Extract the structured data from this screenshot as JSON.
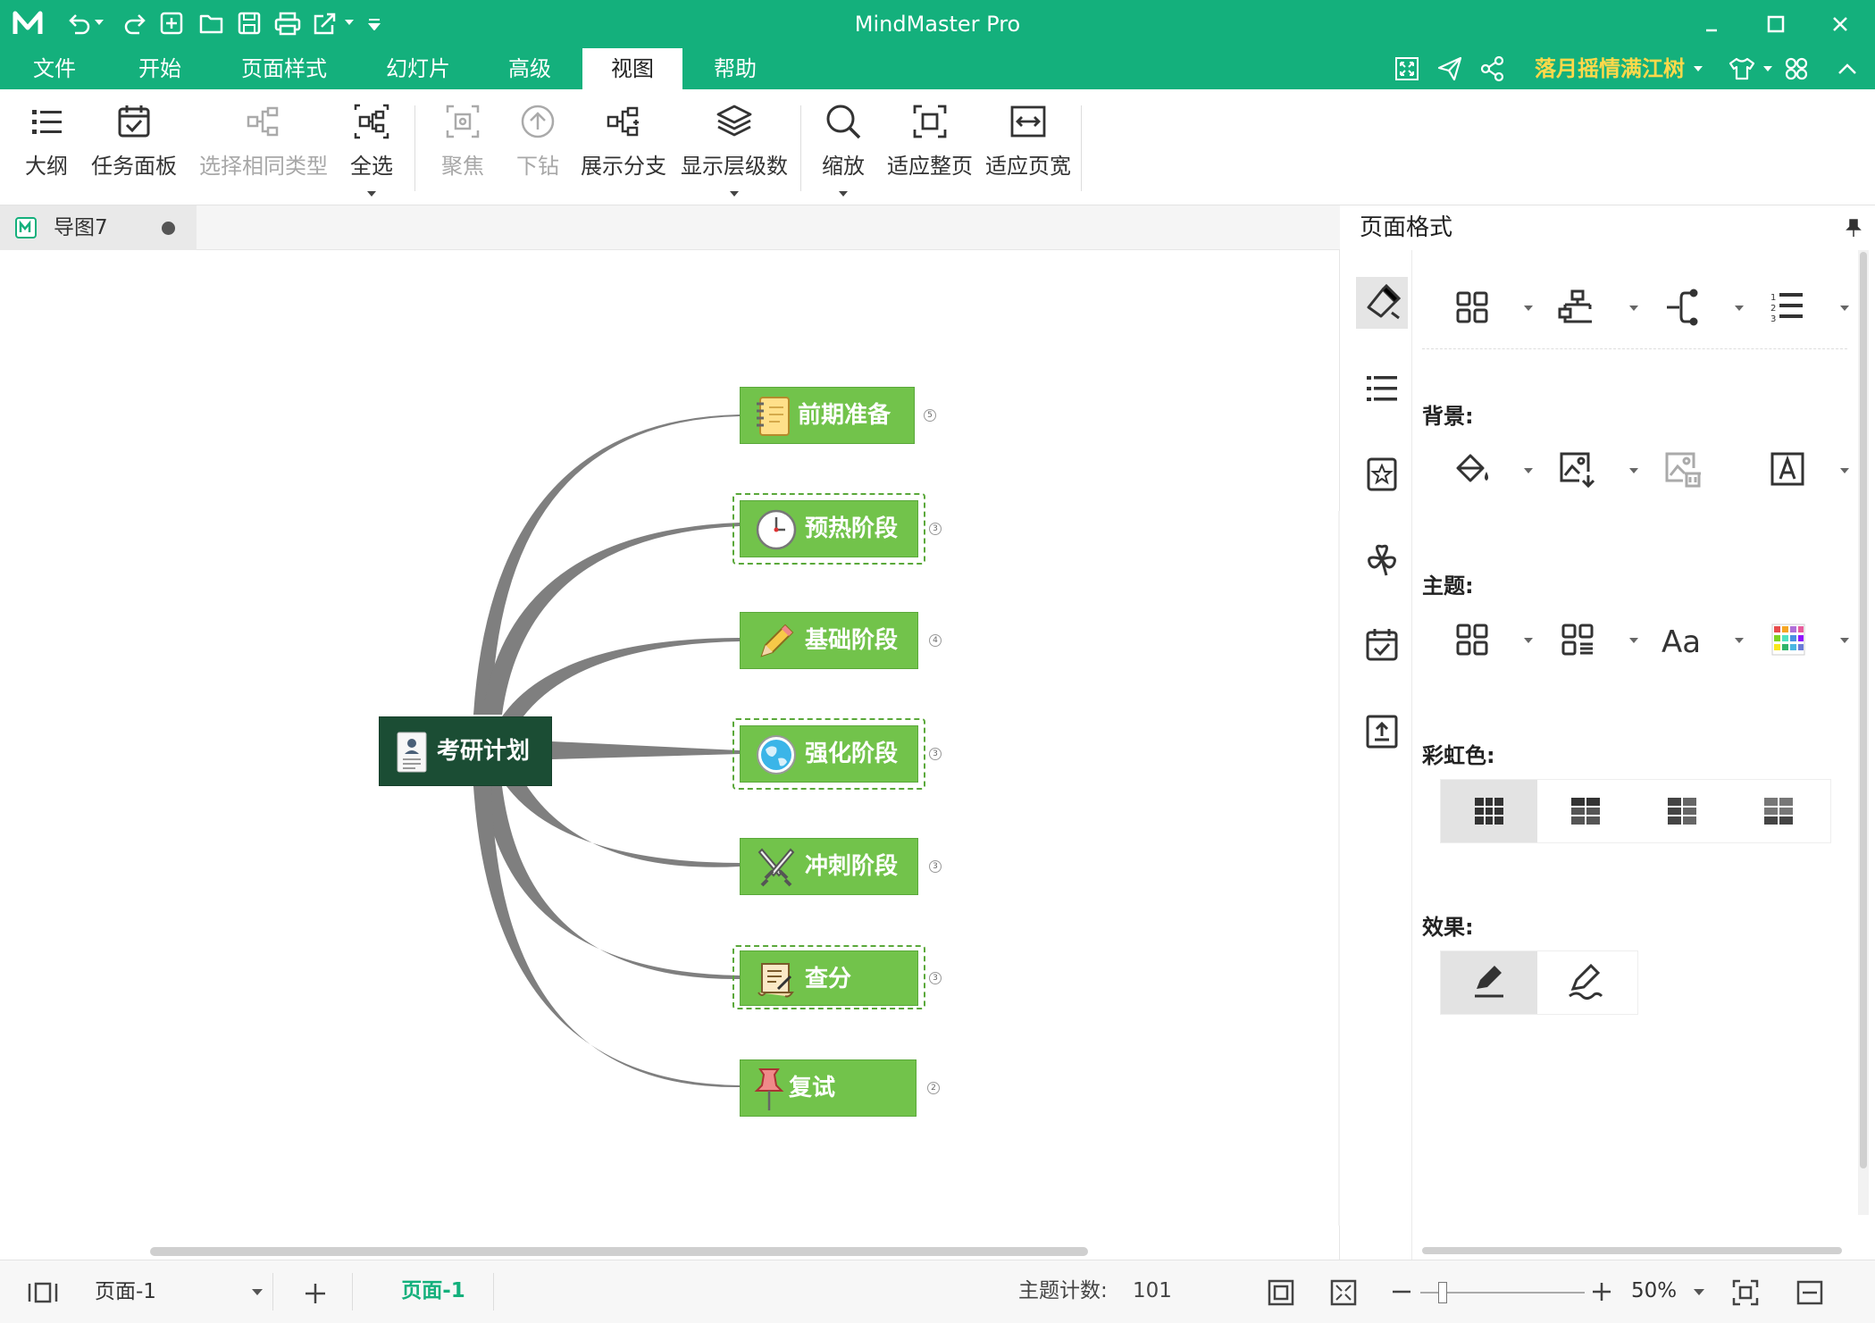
{
  "app": {
    "title": "MindMaster Pro"
  },
  "menu": {
    "items": [
      "文件",
      "开始",
      "页面样式",
      "幻灯片",
      "高级",
      "视图",
      "帮助"
    ],
    "active": "视图"
  },
  "user": {
    "name": "落月摇情满江树"
  },
  "ribbon": {
    "outline": "大纲",
    "task_panel": "任务面板",
    "select_same": "选择相同类型",
    "select_all": "全选",
    "focus": "聚焦",
    "drill_down": "下钻",
    "expand_branch": "展示分支",
    "show_levels": "显示层级数",
    "zoom": "缩放",
    "fit_page": "适应整页",
    "fit_width": "适应页宽"
  },
  "doc_tab": {
    "name": "导图7"
  },
  "mindmap": {
    "root": "考研计划",
    "topics": [
      {
        "label": "前期准备",
        "icon": "notebook-icon",
        "count": "5"
      },
      {
        "label": "预热阶段",
        "icon": "clock-icon",
        "count": "3"
      },
      {
        "label": "基础阶段",
        "icon": "pencil-icon",
        "count": "4"
      },
      {
        "label": "强化阶段",
        "icon": "globe-icon",
        "count": "3"
      },
      {
        "label": "冲刺阶段",
        "icon": "swords-icon",
        "count": "3"
      },
      {
        "label": "查分",
        "icon": "scroll-icon",
        "count": "3"
      },
      {
        "label": "复试",
        "icon": "pushpin-icon",
        "count": "2"
      }
    ],
    "colors": {
      "topic": "#72c34b",
      "root": "#1b4d34",
      "branch": "#7f7f7f"
    }
  },
  "panel": {
    "title": "页面格式",
    "background_label": "背景:",
    "theme_label": "主题:",
    "rainbow_label": "彩虹色:",
    "effect_label": "效果:"
  },
  "status": {
    "page_select": "页面-1",
    "active_page": "页面-1",
    "topic_count_label": "主题计数:",
    "topic_count": "101",
    "zoom": "50%"
  },
  "colors": {
    "accent": "#14b07c"
  }
}
